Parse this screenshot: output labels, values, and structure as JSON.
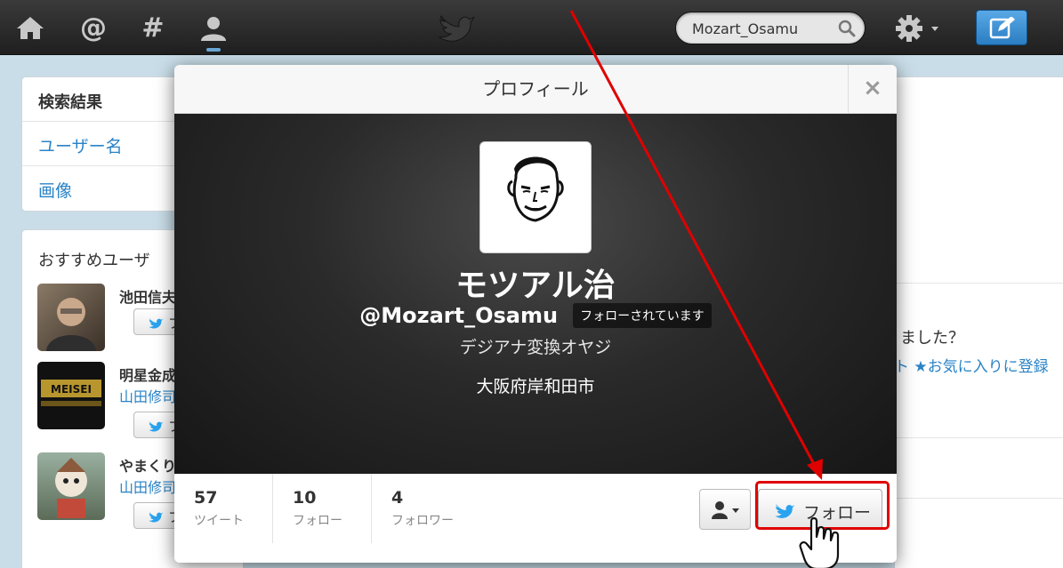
{
  "colors": {
    "accent": "#2a83c6",
    "annotation": "#e00000",
    "topbar": "#2b2b2b"
  },
  "topbar": {
    "icons": [
      "home-icon",
      "at-icon",
      "hashtag-icon",
      "profile-icon",
      "twitter-bird-icon",
      "search-icon",
      "gear-icon",
      "compose-icon"
    ],
    "search_value": "Mozart_Osamu"
  },
  "sidebar": {
    "header": "検索結果",
    "items": [
      {
        "label": "ユーザー名"
      },
      {
        "label": "画像"
      }
    ]
  },
  "recommendations": {
    "header": "おすすめユーザ",
    "items": [
      {
        "name": "池田信夫",
        "by": "",
        "button": "フォ"
      },
      {
        "name": "明星金成",
        "by": "山田修司",
        "button": "フォ"
      },
      {
        "name": "やまくり",
        "by": "山田修司",
        "button": "フォ"
      }
    ]
  },
  "background_main": {
    "question": "ました？",
    "links": "ト ★お気に入りに登録"
  },
  "modal": {
    "title": "プロフィール",
    "close": "×",
    "fullname": "モツアル治",
    "handle": "@Mozart_Osamu",
    "follows_you": "フォローされています",
    "bio": "デジアナ変換オヤジ",
    "location": "大阪府岸和田市",
    "stats": [
      {
        "value": "57",
        "label": "ツイート"
      },
      {
        "value": "10",
        "label": "フォロー"
      },
      {
        "value": "4",
        "label": "フォロワー"
      }
    ],
    "follow_button": "フォロー"
  }
}
